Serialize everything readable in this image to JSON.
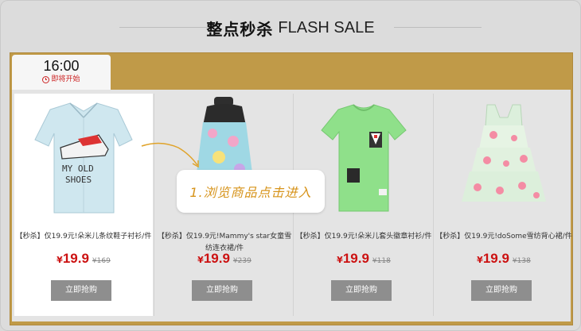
{
  "header": {
    "title_cn": "整点秒杀",
    "title_en": "FLASH SALE"
  },
  "session": {
    "time": "16:00",
    "status": "即将开始"
  },
  "products": [
    {
      "name": "【秒杀】仅19.9元!朵米儿条纹鞋子衬衫/件",
      "currency": "¥",
      "price": "19.9",
      "original_price": "¥169",
      "button": "立即抢购"
    },
    {
      "name": "【秒杀】仅19.9元!Mammy's star女童雪纺连衣裙/件",
      "currency": "¥",
      "price": "19.9",
      "original_price": "¥239",
      "button": "立即抢购"
    },
    {
      "name": "【秒杀】仅19.9元!朵米儿套头徽章衬衫/件",
      "currency": "¥",
      "price": "19.9",
      "original_price": "¥118",
      "button": "立即抢购"
    },
    {
      "name": "【秒杀】仅19.9元!doSome雪纺背心裙/件",
      "currency": "¥",
      "price": "19.9",
      "original_price": "¥138",
      "button": "立即抢购"
    }
  ],
  "annotation": {
    "text": "1.浏览商品点击进入"
  },
  "colors": {
    "accent_gold": "#c09a48",
    "price_red": "#cc1111",
    "button_gray": "#8e8e8e",
    "annotation_orange": "#d7941c"
  }
}
